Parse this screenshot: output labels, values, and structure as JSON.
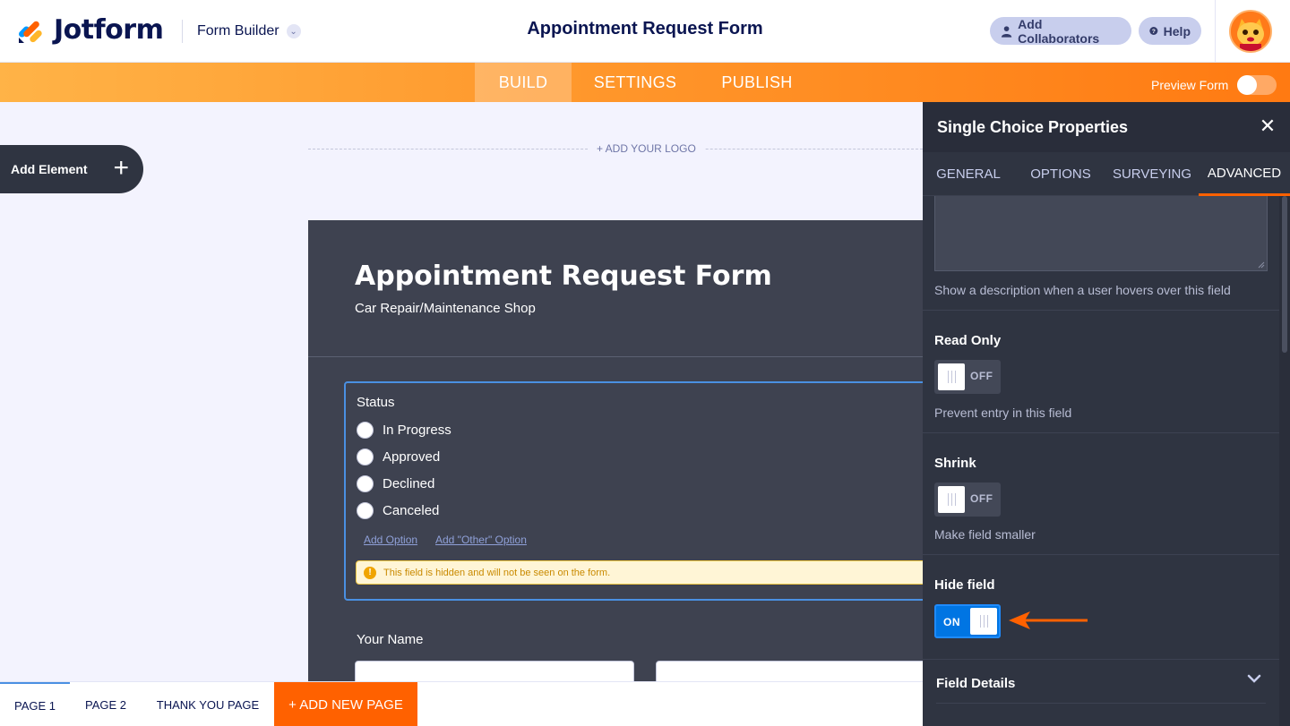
{
  "header": {
    "brand": "Jotform",
    "builder_label": "Form Builder",
    "title": "Appointment Request Form",
    "collaborators_label": "Add Collaborators",
    "help_label": "Help"
  },
  "nav": {
    "tabs": [
      {
        "label": "BUILD",
        "active": true
      },
      {
        "label": "SETTINGS",
        "active": false
      },
      {
        "label": "PUBLISH",
        "active": false
      }
    ],
    "preview_label": "Preview Form",
    "preview_on": false
  },
  "canvas": {
    "add_element_label": "Add Element",
    "add_logo_label": "+ ADD YOUR LOGO",
    "form_title": "Appointment Request Form",
    "form_subtitle": "Car Repair/Maintenance Shop",
    "status_field": {
      "label": "Status",
      "options": [
        "In Progress",
        "Approved",
        "Declined",
        "Canceled"
      ],
      "add_option": "Add Option",
      "add_other_option": "Add \"Other\" Option",
      "warning": "This field is hidden and will not be seen on the form."
    },
    "name_label": "Your Name"
  },
  "pages": {
    "tabs": [
      "PAGE 1",
      "PAGE 2",
      "THANK YOU PAGE"
    ],
    "active_index": 0,
    "add_page_label": "+ ADD NEW PAGE"
  },
  "panel": {
    "title": "Single Choice Properties",
    "tabs": [
      "GENERAL",
      "OPTIONS",
      "SURVEYING",
      "ADVANCED"
    ],
    "active_tab": "ADVANCED",
    "hover_text_help": "Show a description when a user hovers over this field",
    "read_only": {
      "label": "Read Only",
      "state": "OFF",
      "help": "Prevent entry in this field"
    },
    "shrink": {
      "label": "Shrink",
      "state": "OFF",
      "help": "Make field smaller"
    },
    "hide_field": {
      "label": "Hide field",
      "state": "ON"
    },
    "field_details_label": "Field Details"
  },
  "colors": {
    "accent_orange": "#ff6100",
    "toggle_on_blue": "#0075e3",
    "panel_bg": "#2f3441",
    "form_bg": "#3e4250"
  }
}
